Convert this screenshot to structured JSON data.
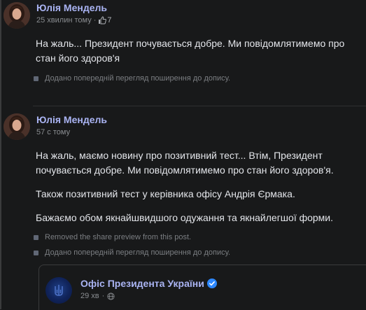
{
  "post1": {
    "author": "Юлія Мендель",
    "time": "25 хвилин тому",
    "separator": "·",
    "reaction_count": "7",
    "text": "На жаль... Президент почувається добре. Ми повідомлятимемо про стан його здоров'я",
    "note": "Додано попередній перегляд поширення до допису."
  },
  "post2": {
    "author": "Юлія Мендель",
    "time": "57 с тому",
    "paragraphs": [
      "На жаль, маємо новину про позитивний тест... Втім, Президент почувається добре. Ми повідомлятимемо про стан його здоров'я.",
      "Також позитивний тест у керівника офісу Андрія Єрмака.",
      "Бажаємо обом якнайшвидшого одужання та якнайлегшої форми."
    ],
    "notes": [
      "Removed the share preview from this post.",
      "Додано попередній перегляд поширення до допису."
    ],
    "share": {
      "name": "Офіс Президента України",
      "time": "29 хв",
      "separator": "·",
      "verified_icon": "verified-badge-icon",
      "privacy_icon": "globe-icon",
      "verified_color": "#2d88ff"
    }
  }
}
